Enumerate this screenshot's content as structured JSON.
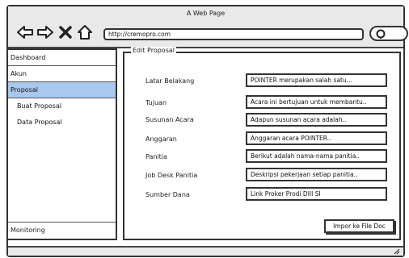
{
  "window": {
    "title": "A Web Page",
    "url": "http://cremopro.com"
  },
  "icons": {
    "back": "arrow-left-icon",
    "forward": "arrow-right-icon",
    "close": "close-icon",
    "home": "home-icon",
    "search": "search-icon",
    "resize": "resize-grip-icon"
  },
  "sidebar": {
    "items": [
      {
        "label": "Dashboard"
      },
      {
        "label": "Akun"
      },
      {
        "label": "Proposal"
      }
    ],
    "subitems": [
      {
        "label": "Buat Proposal"
      },
      {
        "label": "Data Proposal"
      }
    ],
    "bottom_label": "Monitoring",
    "active_color": "#a8c8ee"
  },
  "form": {
    "legend": "Edit Proposal",
    "fields": [
      {
        "label": "Latar Belakang",
        "value": "POINTER merupakan salah satu..."
      },
      {
        "label": "Tujuan",
        "value": "Acara ini bertujuan untuk membantu.."
      },
      {
        "label": "Susunan Acara",
        "value": "Adapun susunan acara adalah.."
      },
      {
        "label": "Anggaran",
        "value": "Anggaran acara POINTER.."
      },
      {
        "label": "Panitia",
        "value": "Berikut adalah nama-nama panitia.."
      },
      {
        "label": "Job Desk Panitia",
        "value": "Deskripsi pekerjaan setiap panitia.."
      },
      {
        "label": "Sumber Dana",
        "value": "Link  Proker Prodi DIII SI"
      }
    ],
    "import_button": "Impor ke File Doc"
  }
}
